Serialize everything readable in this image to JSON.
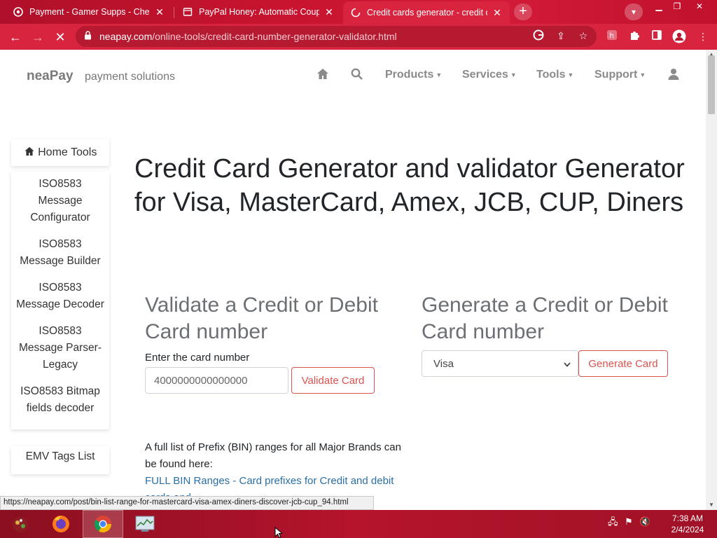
{
  "browser": {
    "tabs": [
      {
        "title": "Payment - Gamer Supps - Check",
        "active": false
      },
      {
        "title": "PayPal Honey: Automatic Coupon",
        "active": false
      },
      {
        "title": "Credit cards generator - credit ca",
        "active": true
      }
    ],
    "url_host": "neapay.com",
    "url_path": "/online-tools/credit-card-number-generator-validator.html",
    "accent_color": "#d8243f"
  },
  "site": {
    "brand": "neaPay",
    "tagline": "payment solutions",
    "nav": {
      "products": "Products",
      "services": "Services",
      "tools": "Tools",
      "support": "Support"
    }
  },
  "sidebar": {
    "home": "Home Tools",
    "items": [
      "ISO8583 Message Configurator",
      "ISO8583 Message Builder",
      "ISO8583 Message Decoder",
      "ISO8583 Message Parser- Legacy",
      "ISO8583 Bitmap fields decoder"
    ],
    "emv": "EMV Tags List"
  },
  "main": {
    "title": "Credit Card Generator and validator Generator for Visa, MasterCard, Amex, JCB, CUP, Diners",
    "validate": {
      "heading": "Validate a Credit or Debit Card number",
      "label": "Enter the card number",
      "input_value": "4000000000000000",
      "button": "Validate Card"
    },
    "generate": {
      "heading": "Generate a Credit or Debit Card number",
      "selected_brand": "Visa",
      "button": "Generate Card"
    },
    "info_text": "A full list of Prefix (BIN) ranges for all Major Brands can be found here:",
    "bin_link": "FULL BIN Ranges - Card prefixes for Credit and debit cards and",
    "link_color": "#2a6fa6",
    "button_color": "#d9534f"
  },
  "status_bar": "https://neapay.com/post/bin-list-range-for-mastercard-visa-amex-diners-discover-jcb-cup_94.html",
  "taskbar": {
    "time": "7:38 AM",
    "date": "2/4/2024"
  }
}
